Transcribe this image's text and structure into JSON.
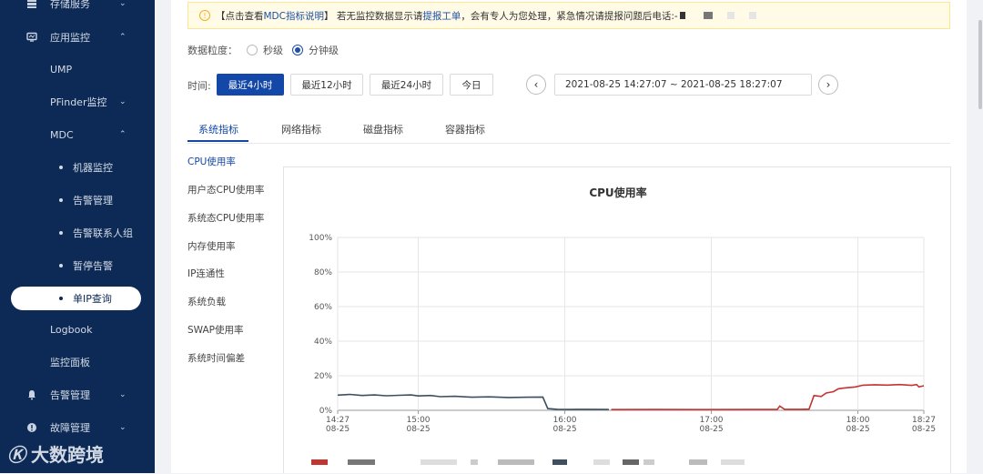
{
  "sidebar": {
    "items": [
      {
        "label": "存储服务",
        "icon": "storage-icon",
        "chevron": "⌄"
      },
      {
        "label": "应用监控",
        "icon": "monitor-icon",
        "chevron": "⌃"
      },
      {
        "label": "UMP"
      },
      {
        "label": "PFinder监控",
        "chevron": "⌄"
      },
      {
        "label": "MDC",
        "chevron": "⌃"
      },
      {
        "label": "机器监控"
      },
      {
        "label": "告警管理"
      },
      {
        "label": "告警联系人组"
      },
      {
        "label": "暂停告警"
      },
      {
        "label": "单IP查询"
      },
      {
        "label": "Logbook"
      },
      {
        "label": "监控面板"
      },
      {
        "label": "告警管理",
        "icon": "bell-icon",
        "chevron": "⌄"
      },
      {
        "label": "故障管理",
        "icon": "fault-icon",
        "chevron": "⌄"
      }
    ]
  },
  "watermark": {
    "logo": "Ⓚ",
    "text": "大数跨境"
  },
  "notice": {
    "prefix": "【点击查看 ",
    "link1": "MDC指标说明",
    "middle": "】 若无监控数据显示请 ",
    "link2": "提报工单",
    "suffix": "，会有专人为您处理，紧急情况请提报问题后电话:-"
  },
  "granularity": {
    "label": "数据粒度：",
    "options": [
      "秒级",
      "分钟级"
    ],
    "selected": "分钟级"
  },
  "time": {
    "label": "时间:",
    "buttons": [
      "最近4小时",
      "最近12小时",
      "最近24小时",
      "今日"
    ],
    "active": "最近4小时",
    "range": "2021-08-25 14:27:07 ~ 2021-08-25 18:27:07",
    "prev_icon": "‹",
    "next_icon": "›"
  },
  "tabs": [
    "系统指标",
    "网络指标",
    "磁盘指标",
    "容器指标"
  ],
  "metrics": [
    "CPU使用率",
    "用户态CPU使用率",
    "系统态CPU使用率",
    "内存使用率",
    "IP连通性",
    "系统负载",
    "SWAP使用率",
    "系统时间偏差"
  ],
  "colors": {
    "sidebar": "#0c2a55",
    "primary": "#1448a8",
    "series_dark": "#3d4f60",
    "series_red": "#c23531"
  },
  "chart_data": {
    "type": "line",
    "title": "CPU使用率",
    "xlabel": "",
    "ylabel": "",
    "ylim": [
      0,
      100
    ],
    "y_ticks": [
      "100%",
      "80%",
      "60%",
      "40%",
      "20%",
      "0%"
    ],
    "x_ticks": [
      {
        "t": "14:27",
        "d": "08-25"
      },
      {
        "t": "15:00",
        "d": "08-25"
      },
      {
        "t": "16:00",
        "d": "08-25"
      },
      {
        "t": "17:00",
        "d": "08-25"
      },
      {
        "t": "18:00",
        "d": "08-25"
      },
      {
        "t": "18:27",
        "d": "08-25"
      }
    ],
    "x_ticks_minutes": [
      0,
      33,
      93,
      153,
      213,
      240
    ],
    "series": [
      {
        "color": "#3d4f60",
        "points": [
          [
            0,
            8.8
          ],
          [
            5,
            9.2
          ],
          [
            10,
            8.6
          ],
          [
            15,
            8.9
          ],
          [
            20,
            8.4
          ],
          [
            25,
            8.7
          ],
          [
            30,
            8.9
          ],
          [
            33,
            8.3
          ],
          [
            38,
            8.6
          ],
          [
            42,
            7.9
          ],
          [
            48,
            8.1
          ],
          [
            55,
            7.6
          ],
          [
            62,
            7.8
          ],
          [
            70,
            7.4
          ],
          [
            78,
            7.6
          ],
          [
            84,
            7.7
          ],
          [
            86,
            1.0
          ],
          [
            90,
            0.6
          ],
          [
            95,
            0.5
          ],
          [
            100,
            0.6
          ],
          [
            110,
            0.5
          ],
          [
            111,
            0.5
          ]
        ]
      },
      {
        "color": "#c23531",
        "points": [
          [
            112,
            0.4
          ],
          [
            130,
            0.5
          ],
          [
            150,
            0.4
          ],
          [
            170,
            0.5
          ],
          [
            180,
            0.5
          ],
          [
            181,
            2.5
          ],
          [
            183,
            0.6
          ],
          [
            190,
            0.6
          ],
          [
            193,
            0.7
          ],
          [
            195,
            8.5
          ],
          [
            198,
            8.0
          ],
          [
            200,
            10.0
          ],
          [
            203,
            10.8
          ],
          [
            205,
            12.5
          ],
          [
            208,
            13.0
          ],
          [
            212,
            13.5
          ],
          [
            215,
            14.5
          ],
          [
            220,
            14.8
          ],
          [
            225,
            14.6
          ],
          [
            230,
            14.9
          ],
          [
            235,
            14.4
          ],
          [
            237,
            14.9
          ],
          [
            238,
            13.5
          ],
          [
            240,
            14.2
          ]
        ]
      }
    ]
  }
}
